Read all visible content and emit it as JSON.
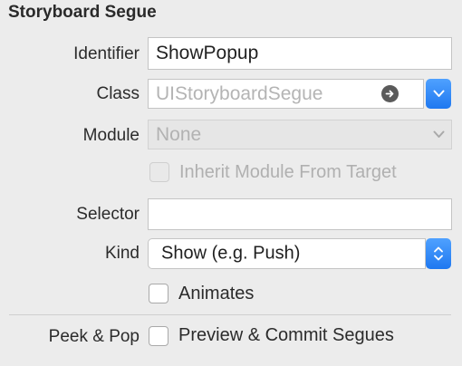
{
  "section": {
    "title": "Storyboard Segue"
  },
  "identifier": {
    "label": "Identifier",
    "value": "ShowPopup"
  },
  "class": {
    "label": "Class",
    "placeholder": "UIStoryboardSegue"
  },
  "module": {
    "label": "Module",
    "placeholder": "None"
  },
  "inherit_module": {
    "label": "Inherit Module From Target",
    "checked": false,
    "enabled": false
  },
  "selector": {
    "label": "Selector",
    "value": ""
  },
  "kind": {
    "label": "Kind",
    "selected": "Show (e.g. Push)"
  },
  "animates": {
    "label": "Animates",
    "checked": false
  },
  "peek_pop": {
    "label": "Peek & Pop",
    "option_label": "Preview & Commit Segues",
    "checked": false
  },
  "colors": {
    "accent": "#2f86f7",
    "background": "#ececec"
  },
  "icons": [
    "arrow-right-circle-icon",
    "chevron-down-icon",
    "chevron-up-down-icon"
  ]
}
